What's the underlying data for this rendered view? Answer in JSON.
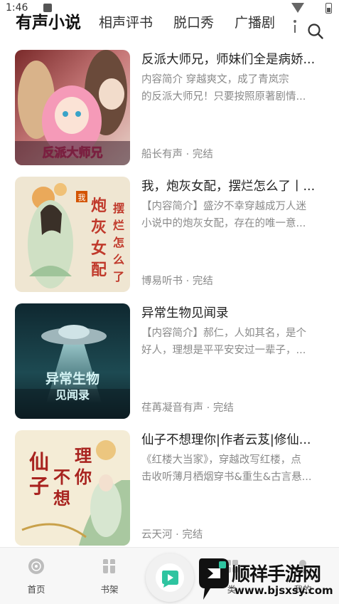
{
  "status_bar": {
    "time": "1:46"
  },
  "tabs": [
    {
      "label": "有声小说",
      "active": true
    },
    {
      "label": "相声评书",
      "active": false
    },
    {
      "label": "脱口秀",
      "active": false
    },
    {
      "label": "广播剧",
      "active": false
    }
  ],
  "books": [
    {
      "title": "反派大师兄，师妹们全是病娇...",
      "desc_line1": "内容简介 穿越爽文，成了青岚宗",
      "desc_line2": "的反派大师兄！只要按照原著剧情...",
      "meta": "船长有声 · 完结",
      "cover_text": "反派大师兄",
      "cover_icon": "anime-girls-cover"
    },
    {
      "title": "我，炮灰女配，摆烂怎么了丨...",
      "desc_line1": "【内容简介】盛汐不幸穿越成万人迷",
      "desc_line2": "小说中的炮灰女配，存在的唯一意...",
      "meta": "博易听书 · 完结",
      "cover_text": "我炮灰女配 摆烂怎么了",
      "cover_icon": "ancient-lady-cover"
    },
    {
      "title": "异常生物见闻录",
      "desc_line1": "【内容简介】郝仁，人如其名，是个",
      "desc_line2": "好人，理想是平平安安过一辈子，...",
      "meta": "荏苒凝音有声 · 完结",
      "cover_text": "异常生物见闻录",
      "cover_icon": "ufo-cover"
    },
    {
      "title": "仙子不想理你|作者云芨|修仙...",
      "desc_line1": "《红楼大当家》，穿越改写红楼，点",
      "desc_line2": "击收听薄月栖烟穿书&重生&古言悬...",
      "meta": "云天河 · 完结",
      "cover_text": "仙子不想理你",
      "cover_icon": "fairy-cover"
    }
  ],
  "bottom_nav": {
    "home_label": "首页",
    "shelf_label": "书架",
    "category_label": "类",
    "mine_label": "我的"
  },
  "watermark": {
    "name": "顺祥手游网",
    "url": "www.bjsxsy.com"
  },
  "colors": {
    "accent": "#2ec4a0",
    "meta": "#8a8a8a"
  }
}
